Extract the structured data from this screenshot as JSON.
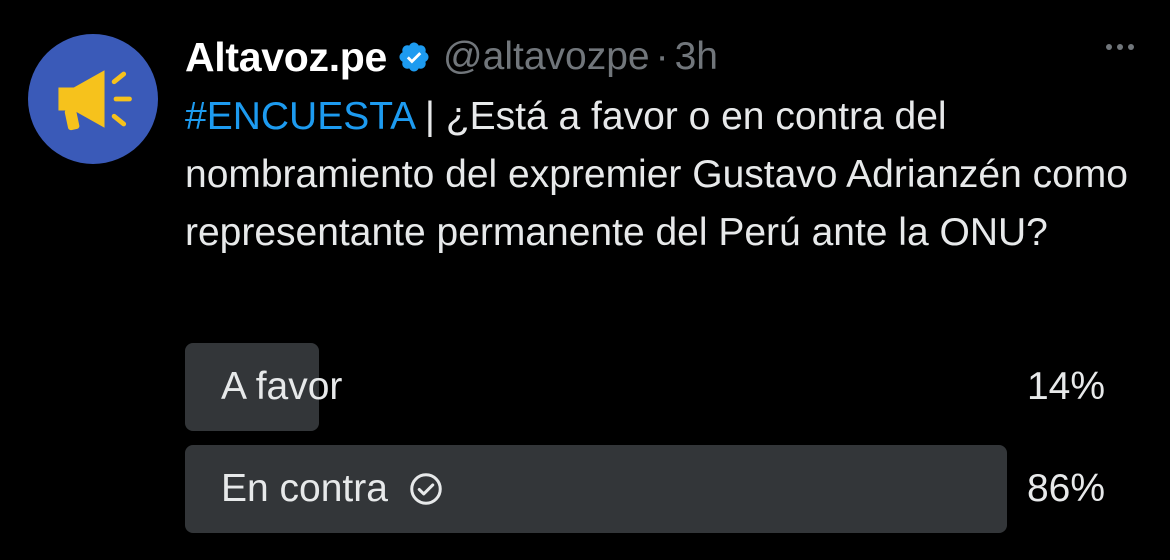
{
  "tweet": {
    "author": {
      "display_name": "Altavoz.pe",
      "handle": "@altavozpe",
      "separator": "·",
      "time": "3h",
      "avatar_icon": "megaphone-icon",
      "avatar_color": "#3a5ab8",
      "verified": true,
      "verified_color": "#1d9bf0"
    },
    "text": {
      "hashtag": "#ENCUESTA",
      "body": " | ¿Está a favor o en contra del nombramiento del expremier Gustavo Adrianzén como representante permanente del Perú ante la ONU?"
    },
    "poll": {
      "options": [
        {
          "label": "A favor",
          "percent_text": "14%",
          "percent": 14,
          "selected": false
        },
        {
          "label": "En contra",
          "percent_text": "86%",
          "percent": 86,
          "selected": true
        }
      ]
    }
  }
}
